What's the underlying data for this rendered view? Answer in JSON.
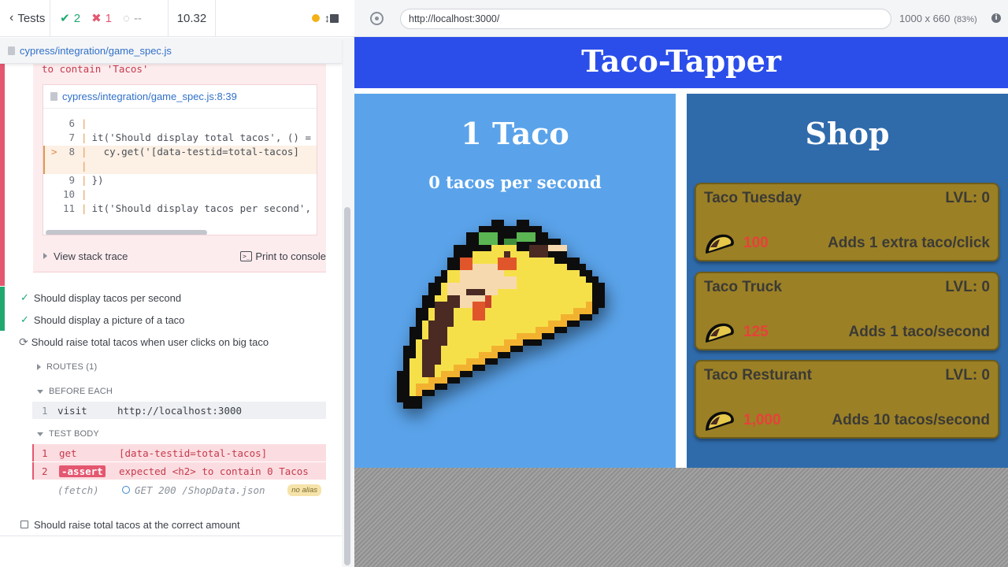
{
  "reporter": {
    "tests_label": "Tests",
    "passed": "2",
    "failed": "1",
    "pending": "--",
    "duration": "10.32",
    "spec_path": "cypress/integration/game_spec.js",
    "error_tail": "to contain 'Tacos'",
    "code_frame": {
      "file": "cypress/integration/game_spec.js:8:39",
      "lines": [
        {
          "n": "6",
          "code": ""
        },
        {
          "n": "7",
          "code": "it('Should display total tacos', () ="
        },
        {
          "n": "8",
          "code": "  cy.get('[data-testid=total-tacos]",
          "highlight": true,
          "marker": ">"
        },
        {
          "n": "",
          "code": ""
        },
        {
          "n": "9",
          "code": "})"
        },
        {
          "n": "10",
          "code": ""
        },
        {
          "n": "11",
          "code": "it('Should display tacos per second',"
        }
      ]
    },
    "view_stack_trace": "View stack trace",
    "print_to_console": "Print to console",
    "tests": [
      {
        "title": "Should display tacos per second",
        "state": "passed"
      },
      {
        "title": "Should display a picture of a taco",
        "state": "passed"
      },
      {
        "title": "Should raise total tacos when user clicks on big taco",
        "state": "running"
      },
      {
        "title": "Should raise total tacos at the correct amount",
        "state": "pending"
      }
    ],
    "routes_label": "ROUTES (1)",
    "before_each_label": "BEFORE EACH",
    "test_body_label": "TEST BODY",
    "before_each_cmds": [
      {
        "num": "1",
        "name": "visit",
        "msg": "http://localhost:3000"
      }
    ],
    "test_body_cmds": [
      {
        "num": "1",
        "name": "get",
        "msg": "[data-testid=total-tacos]"
      },
      {
        "num": "2",
        "name": "-assert",
        "msg": "expected <h2> to contain 0 Tacos"
      }
    ],
    "fetch_cmd": {
      "name": "(fetch)",
      "msg": "GET 200 /ShopData.json",
      "alias": "no alias"
    }
  },
  "browser": {
    "url": "http://localhost:3000/",
    "viewport": "1000 x 660",
    "zoom": "(83%)"
  },
  "app": {
    "title": "Taco-Tapper",
    "total_tacos": "1 Taco",
    "per_second": "0 tacos per second",
    "shop_title": "Shop",
    "shop_items": [
      {
        "name": "Taco Tuesday",
        "level": "LVL: 0",
        "price": "100",
        "desc": "Adds 1 extra taco/click"
      },
      {
        "name": "Taco Truck",
        "level": "LVL: 0",
        "price": "125",
        "desc": "Adds 1 taco/second"
      },
      {
        "name": "Taco Resturant",
        "level": "LVL: 0",
        "price": "1,000",
        "desc": "Adds 10 tacos/second"
      }
    ]
  },
  "colors": {
    "header_blue": "#2b4eea",
    "taco_panel": "#5aa3ea",
    "shop_panel": "#2f6bab",
    "shop_item": "#9b8026",
    "price_red": "#e8413a",
    "pass_green": "#1fa971",
    "fail_red": "#e45770"
  }
}
